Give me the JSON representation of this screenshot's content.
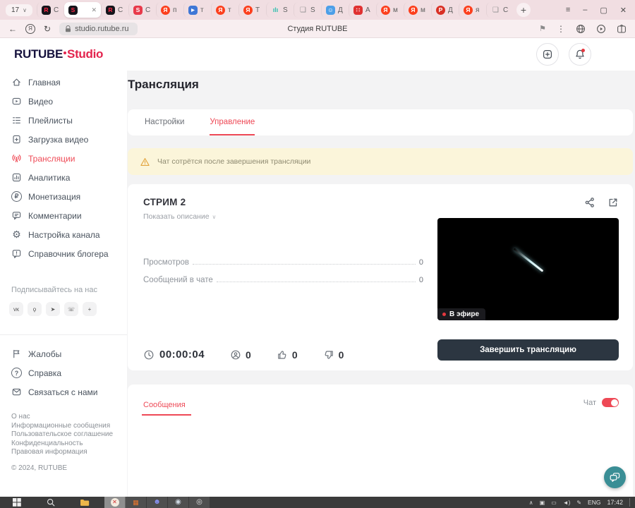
{
  "browser": {
    "tab_counter": "17",
    "tab_counter_chevron": "∨",
    "tabs": [
      {
        "cls": "btab",
        "icon": "R",
        "icon_style": "background:#15151b;color:#ff2645;border-radius:4px",
        "label": "С",
        "close": ""
      },
      {
        "cls": "btab active",
        "icon": "S",
        "icon_style": "background:#15151b;color:#ff2645;border-radius:4px",
        "label": "",
        "close": "✕"
      },
      {
        "cls": "btab",
        "icon": "R",
        "icon_style": "background:#15151b;color:#ff2645;border-radius:4px",
        "label": "С",
        "close": ""
      },
      {
        "cls": "btab",
        "icon": "S",
        "icon_style": "background:#e8394a;color:#fff;border-radius:4px",
        "label": "С",
        "close": ""
      },
      {
        "cls": "btab",
        "icon": "Я",
        "icon_style": "background:#fc3f1d;color:#fff;border-radius:50%",
        "label": "п",
        "close": ""
      },
      {
        "cls": "btab",
        "icon": "▶",
        "icon_style": "background:#3f77d6;color:#fff;border-radius:4px;font-size:6px",
        "label": "т",
        "close": ""
      },
      {
        "cls": "btab",
        "icon": "Я",
        "icon_style": "background:#fc3f1d;color:#fff;border-radius:50%",
        "label": "т",
        "close": ""
      },
      {
        "cls": "btab",
        "icon": "Я",
        "icon_style": "background:#fc3f1d;color:#fff;border-radius:50%",
        "label": "Т",
        "close": ""
      },
      {
        "cls": "btab",
        "icon": "ılı",
        "icon_style": "background:transparent;color:#2fbfae;font-size:9px",
        "label": "S",
        "close": ""
      },
      {
        "cls": "btab",
        "icon": "❏",
        "icon_style": "background:transparent;color:#8f8f8f;font-size:10px;font-weight:400",
        "label": "S",
        "close": ""
      },
      {
        "cls": "btab",
        "icon": "☺",
        "icon_style": "background:#4d9fe8;color:#fff;border-radius:4px",
        "label": "Д",
        "close": ""
      },
      {
        "cls": "btab",
        "icon": "∷",
        "icon_style": "background:#e03131;color:#fff;border-radius:4px",
        "label": "А",
        "close": ""
      },
      {
        "cls": "btab",
        "icon": "Я",
        "icon_style": "background:#fc3f1d;color:#fff;border-radius:50%",
        "label": "м",
        "close": ""
      },
      {
        "cls": "btab",
        "icon": "Я",
        "icon_style": "background:#fc3f1d;color:#fff;border-radius:50%",
        "label": "м",
        "close": ""
      },
      {
        "cls": "btab",
        "icon": "P",
        "icon_style": "background:#d93025;color:#fff;border-radius:50%",
        "label": "Д",
        "close": ""
      },
      {
        "cls": "btab",
        "icon": "Я",
        "icon_style": "background:#fc3f1d;color:#fff;border-radius:50%",
        "label": "я",
        "close": ""
      },
      {
        "cls": "btab",
        "icon": "❏",
        "icon_style": "background:transparent;color:#8f8f8f;font-size:10px;font-weight:400",
        "label": "С",
        "close": ""
      }
    ],
    "new_tab_label": "+",
    "menu_icon": "≡",
    "minimize_icon": "–",
    "maximize_icon": "▢",
    "close_icon": "✕",
    "back_icon": "←",
    "ya_icon": "Я",
    "refresh_icon": "↻",
    "url": "studio.rutube.ru",
    "page_title": "Студия RUTUBE",
    "bookmark_icon": "⚑",
    "more_icon": "⋮"
  },
  "header": {
    "logo_main": "RUTUBE",
    "logo_accent": "Studio"
  },
  "sidebar": {
    "items": [
      {
        "label": "Главная"
      },
      {
        "label": "Видео"
      },
      {
        "label": "Плейлисты"
      },
      {
        "label": "Загрузка видео"
      },
      {
        "label": "Трансляции"
      },
      {
        "label": "Аналитика"
      },
      {
        "label": "Монетизация"
      },
      {
        "label": "Комментарии"
      },
      {
        "label": "Настройка канала"
      },
      {
        "label": "Справочник блогера"
      }
    ],
    "ruble_glyph": "₽",
    "gear_glyph": "⚙",
    "question_glyph": "?",
    "follow_label": "Подписывайтесь на нас",
    "social": [
      {
        "name": "vk",
        "glyph": "ᴠᴋ"
      },
      {
        "name": "ok",
        "glyph": "ϙ"
      },
      {
        "name": "telegram",
        "glyph": "➤"
      },
      {
        "name": "viber",
        "glyph": "☏"
      },
      {
        "name": "more",
        "glyph": "+"
      }
    ],
    "support": [
      {
        "label": "Жалобы"
      },
      {
        "label": "Справка"
      },
      {
        "label": "Связаться с нами"
      }
    ],
    "footer_links": [
      "О нас",
      "Информационные сообщения",
      "Пользовательское соглашение",
      "Конфиденциальность",
      "Правовая информация"
    ],
    "copyright": "© 2024, RUTUBE"
  },
  "main": {
    "page_title": "Трансляция",
    "tabs": [
      {
        "label": "Настройки"
      },
      {
        "label": "Управление"
      }
    ],
    "warning_text": "Чат сотрётся после завершения трансляции",
    "stream": {
      "title": "СТРИМ 2",
      "show_description_label": "Показать описание",
      "show_description_chevron": "∨",
      "stats": [
        {
          "label": "Просмотров",
          "value": "0"
        },
        {
          "label": "Сообщений в чате",
          "value": "0"
        }
      ],
      "live_badge": "В эфире",
      "duration": "00:00:04",
      "viewers": "0",
      "likes": "0",
      "dislikes": "0",
      "end_button_label": "Завершить трансляцию"
    },
    "messages_tab_label": "Сообщения",
    "chat_label": "Чат",
    "chat_enabled": true
  },
  "taskbar": {
    "apps": [
      {
        "tile": "background:#8f8f8f",
        "icon": "✕",
        "icon_style": "background:#f3ece0;color:#d22c2c;border-radius:50%;font-size:8px"
      },
      {
        "tile": "background:#4f4f4f",
        "icon": "▦",
        "icon_style": "color:#e8762d"
      },
      {
        "tile": "background:#4f4f4f",
        "icon": "☻",
        "icon_style": "color:#8891f2;font-size:10px"
      },
      {
        "tile": "background:#4f4f4f",
        "icon": "◉",
        "icon_style": "color:#cdd6e0;font-size:10px"
      },
      {
        "tile": "background:#4f4f4f",
        "icon": "◎",
        "icon_style": "color:#e0e0e0;font-size:10px"
      }
    ],
    "tray": [
      "∧",
      "▣",
      "▭",
      "◄)",
      "✎"
    ],
    "tray_lang": "ENG",
    "tray_time": "17:42"
  },
  "colors": {
    "accent": "#ee4956",
    "logo_red": "#e3234d",
    "dark_button": "#2c3641",
    "teal_chat": "#3a8e95",
    "warning_bg": "#fbf5da",
    "tabstrip_bg": "#f1dee2"
  }
}
